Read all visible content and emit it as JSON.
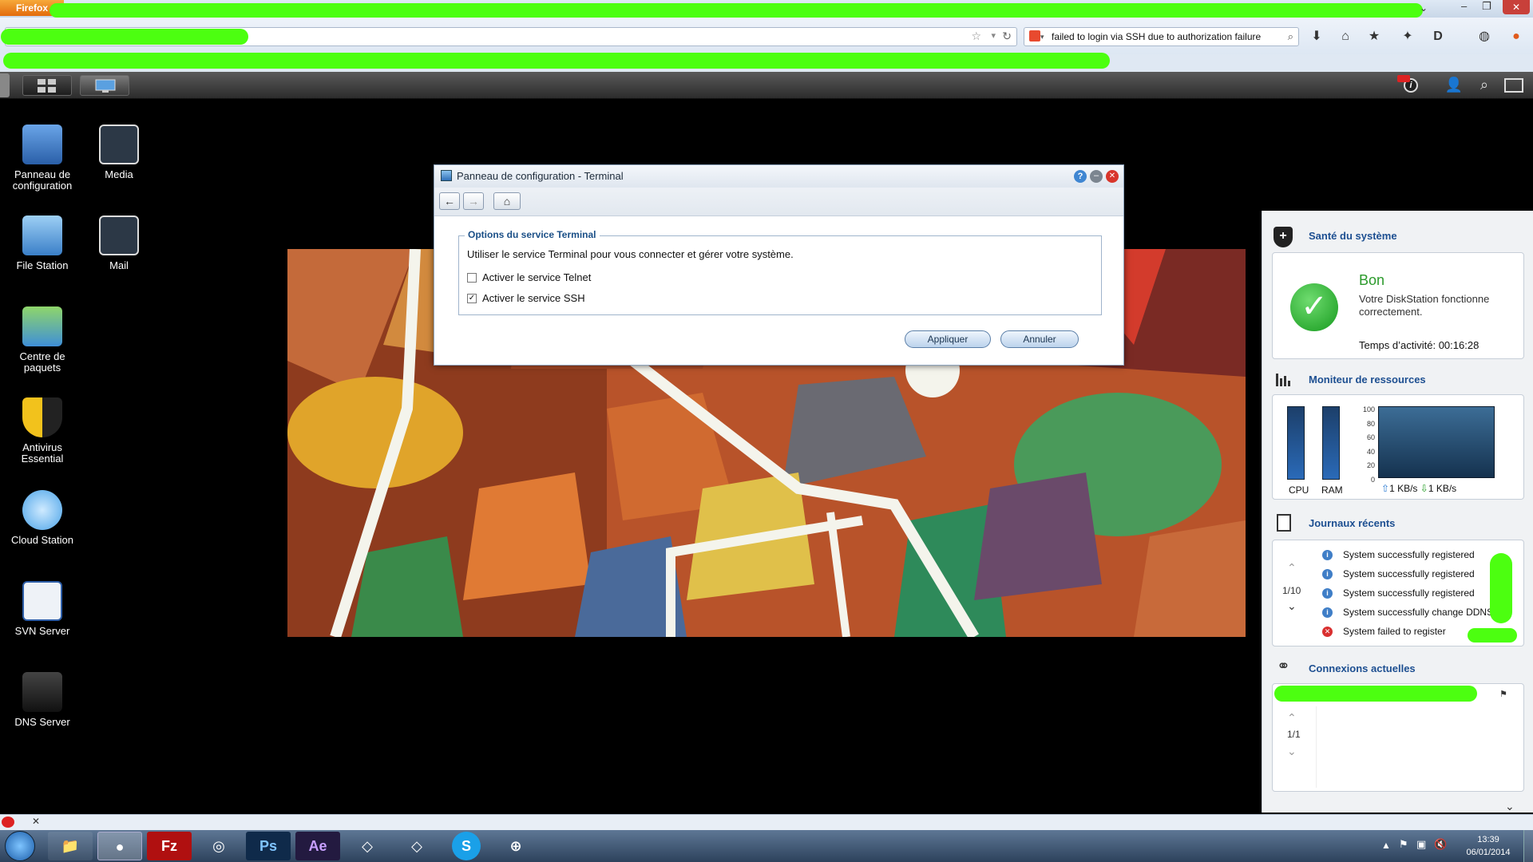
{
  "firefox": {
    "button_label": "Firefox",
    "search_text": "failed to login via SSH due to authorization failure"
  },
  "desktop_icons": [
    {
      "label": "Panneau de configuration"
    },
    {
      "label": "Media"
    },
    {
      "label": "File Station"
    },
    {
      "label": "Mail"
    },
    {
      "label": "Centre de paquets"
    },
    {
      "label": "Antivirus Essential"
    },
    {
      "label": "Cloud Station"
    },
    {
      "label": "SVN Server"
    },
    {
      "label": "DNS Server"
    }
  ],
  "dialog": {
    "title": "Panneau de configuration - Terminal",
    "section_title": "Options du service Terminal",
    "description": "Utiliser le service Terminal pour vous connecter et gérer votre système.",
    "options": [
      {
        "label": "Activer le service Telnet",
        "checked": false
      },
      {
        "label": "Activer le service SSH",
        "checked": true
      }
    ],
    "apply_label": "Appliquer",
    "cancel_label": "Annuler"
  },
  "widgets": {
    "health": {
      "title": "Santé du système",
      "status": "Bon",
      "message": "Votre DiskStation fonctionne correctement.",
      "uptime": "Temps d’activité: 00:16:28"
    },
    "resources": {
      "title": "Moniteur de ressources",
      "cpu_label": "CPU",
      "ram_label": "RAM",
      "y_ticks": [
        "100",
        "80",
        "60",
        "40",
        "20",
        "0"
      ],
      "upload": "1 KB/s",
      "download": "1 KB/s"
    },
    "logs": {
      "title": "Journaux récents",
      "page": "1/10",
      "entries": [
        {
          "type": "info",
          "text": "System successfully registered"
        },
        {
          "type": "info",
          "text": "System successfully registered"
        },
        {
          "type": "info",
          "text": "System successfully registered"
        },
        {
          "type": "info",
          "text": "System successfully change DDNS"
        },
        {
          "type": "error",
          "text": "System failed to register"
        }
      ]
    },
    "connections": {
      "title": "Connexions actuelles",
      "page": "1/1"
    }
  },
  "taskbar": {
    "time": "13:39",
    "date": "06/01/2014"
  },
  "colors": {
    "redaction": "#4cff10",
    "widget_title": "#1d4f91",
    "dialog_legend": "#1a4f87"
  }
}
